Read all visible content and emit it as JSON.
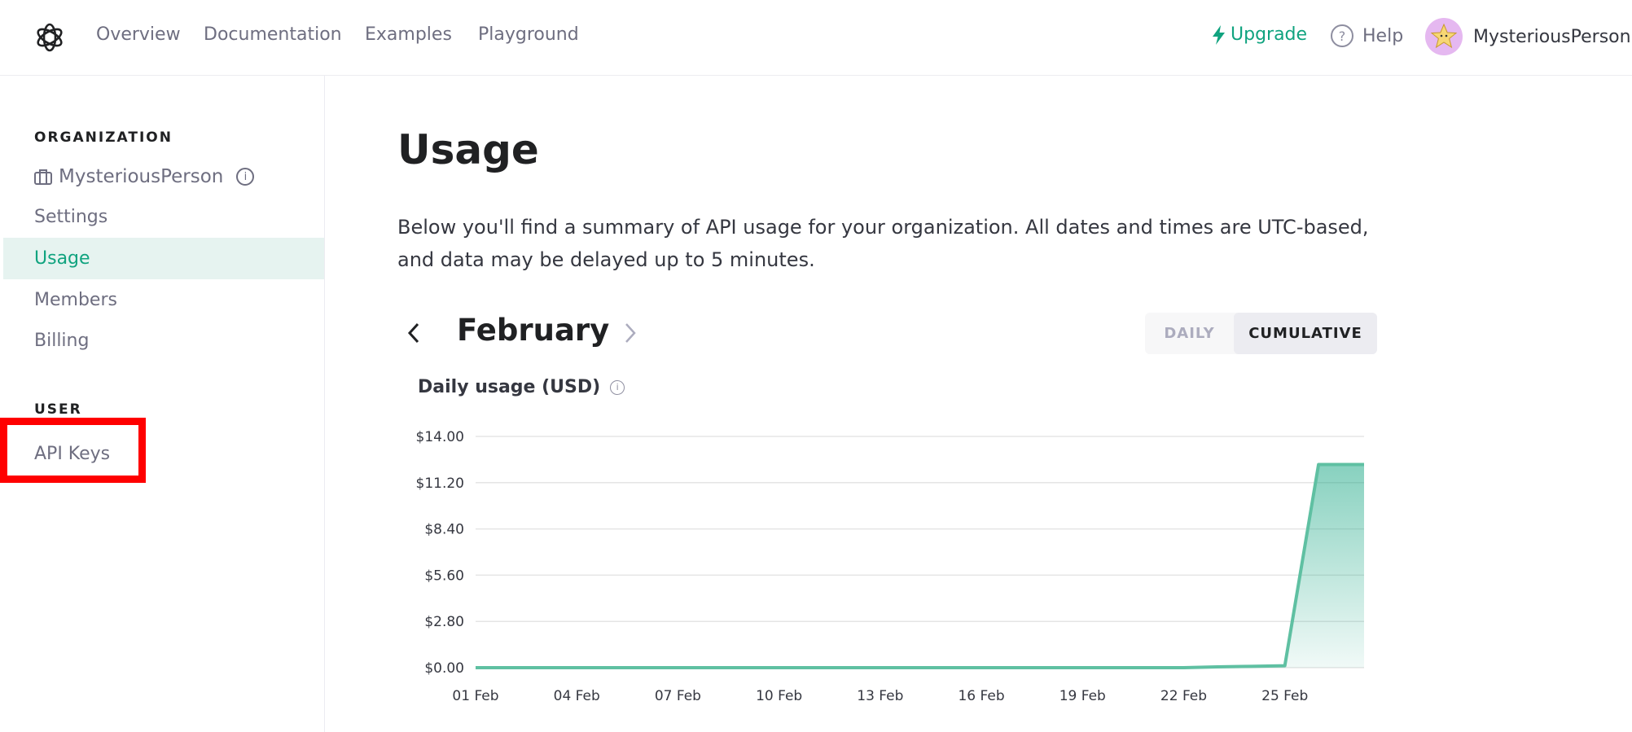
{
  "header": {
    "nav": [
      "Overview",
      "Documentation",
      "Examples",
      "Playground"
    ],
    "upgrade_label": "Upgrade",
    "help_label": "Help",
    "username": "MysteriousPerson"
  },
  "sidebar": {
    "org_section_label": "ORGANIZATION",
    "org_name": "MysteriousPerson",
    "org_items": [
      "Settings",
      "Usage",
      "Members",
      "Billing"
    ],
    "active_item": "Usage",
    "user_section_label": "USER",
    "user_items": [
      "API Keys"
    ]
  },
  "main": {
    "title": "Usage",
    "description": "Below you'll find a summary of API usage for your organization. All dates and times are UTC-based, and data may be delayed up to 5 minutes.",
    "month": "February",
    "toggle": {
      "daily_label": "DAILY",
      "cumulative_label": "CUMULATIVE",
      "selected": "CUMULATIVE"
    },
    "chart_title": "Daily usage (USD)"
  },
  "colors": {
    "accent": "#10a37f",
    "chart_line": "#5fc0a2",
    "chart_fill": "#10a37f",
    "highlight": "#ff0000"
  },
  "chart_data": {
    "type": "area",
    "title": "Daily usage (USD)",
    "xlabel": "",
    "ylabel": "",
    "x": [
      "01 Feb",
      "02 Feb",
      "03 Feb",
      "04 Feb",
      "05 Feb",
      "06 Feb",
      "07 Feb",
      "08 Feb",
      "09 Feb",
      "10 Feb",
      "11 Feb",
      "12 Feb",
      "13 Feb",
      "14 Feb",
      "15 Feb",
      "16 Feb",
      "17 Feb",
      "18 Feb",
      "19 Feb",
      "20 Feb",
      "21 Feb",
      "22 Feb",
      "23 Feb",
      "24 Feb",
      "25 Feb",
      "26 Feb",
      "27 Feb"
    ],
    "series": [
      {
        "values": [
          0,
          0,
          0,
          0,
          0,
          0,
          0,
          0,
          0,
          0,
          0,
          0,
          0,
          0,
          0,
          0,
          0,
          0,
          0,
          0,
          0,
          0,
          0.05,
          0.08,
          0.12,
          12.3,
          12.3
        ]
      }
    ],
    "x_tick_labels": [
      "01 Feb",
      "04 Feb",
      "07 Feb",
      "10 Feb",
      "13 Feb",
      "16 Feb",
      "19 Feb",
      "22 Feb",
      "25 Feb"
    ],
    "y_tick_labels": [
      "$0.00",
      "$2.80",
      "$5.60",
      "$8.40",
      "$11.20",
      "$14.00"
    ],
    "y_ticks": [
      0,
      2.8,
      5.6,
      8.4,
      11.2,
      14
    ],
    "ylim": [
      0,
      14
    ],
    "grid": true
  }
}
